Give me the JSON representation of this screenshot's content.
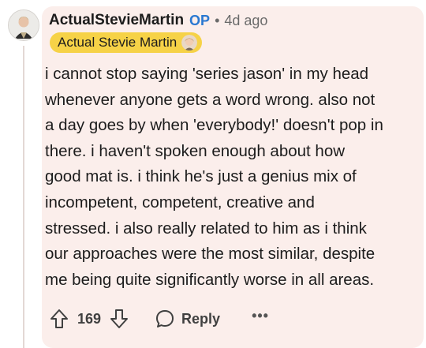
{
  "comment": {
    "author": "ActualStevieMartin",
    "op_badge": "OP",
    "separator": "•",
    "timestamp": "4d ago",
    "flair": "Actual Stevie Martin",
    "body_lines": [
      "i cannot stop saying 'series jason' in my head",
      "whenever anyone gets a word wrong. also not",
      "a day goes by when 'everybody!' doesn't pop in",
      "there. i haven't spoken enough about how",
      "good mat is. i think he's just a genius mix of",
      "incompetent, competent, creative and",
      "stressed. i also really related to him as i think",
      "our approaches were the most similar, despite",
      "me being quite significantly worse in all areas."
    ],
    "vote_count": "169",
    "reply_label": "Reply",
    "more_label": "•••"
  },
  "colors": {
    "card_background": "#fbeeeb",
    "op_color": "#2a78d1",
    "flair_background": "#f6d247"
  },
  "icons": {
    "upvote": "arrow-up-outline-icon",
    "downvote": "arrow-down-outline-icon",
    "reply": "speech-bubble-icon",
    "more": "ellipsis-icon"
  }
}
